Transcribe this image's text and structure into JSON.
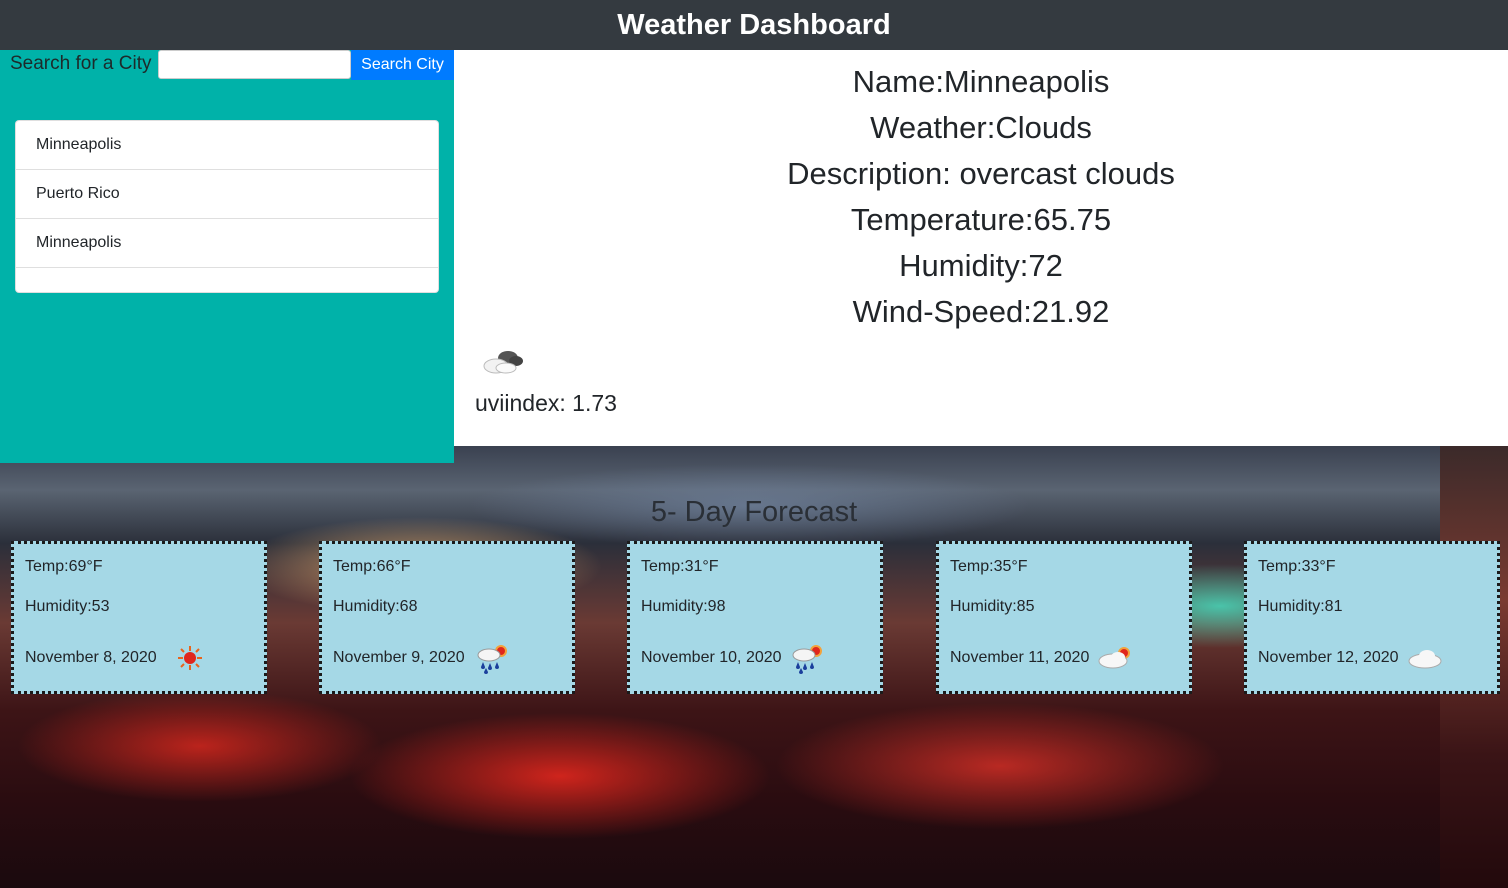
{
  "header": {
    "title": "Weather Dashboard"
  },
  "search": {
    "label": "Search for a City",
    "input_value": "",
    "button_label": "Search City"
  },
  "history": [
    {
      "label": "Minneapolis"
    },
    {
      "label": "Puerto Rico"
    },
    {
      "label": "Minneapolis"
    }
  ],
  "current": {
    "name": "Name:Minneapolis",
    "weather": "Weather:Clouds",
    "description": "Description: overcast clouds",
    "temperature": "Temperature:65.75",
    "humidity": "Humidity:72",
    "wind": "Wind-Speed:21.92",
    "icon": "cloudy-icon",
    "uv": "uviindex: 1.73"
  },
  "forecast": {
    "title": "5- Day Forecast",
    "days": [
      {
        "temp": "Temp:69°F",
        "humidity": "Humidity:53",
        "date": "November 8, 2020",
        "icon": "sun-icon"
      },
      {
        "temp": "Temp:66°F",
        "humidity": "Humidity:68",
        "date": "November 9, 2020",
        "icon": "rain-sun-icon"
      },
      {
        "temp": "Temp:31°F",
        "humidity": "Humidity:98",
        "date": "November 10, 2020",
        "icon": "rain-sun-icon"
      },
      {
        "temp": "Temp:35°F",
        "humidity": "Humidity:85",
        "date": "November 11, 2020",
        "icon": "cloud-sun-icon"
      },
      {
        "temp": "Temp:33°F",
        "humidity": "Humidity:81",
        "date": "November 12, 2020",
        "icon": "cloud-icon"
      }
    ]
  },
  "colors": {
    "header_bg": "#343a40",
    "sidebar_bg": "#00b2a9",
    "button_bg": "#007bff",
    "card_bg": "#a5d8e6"
  }
}
